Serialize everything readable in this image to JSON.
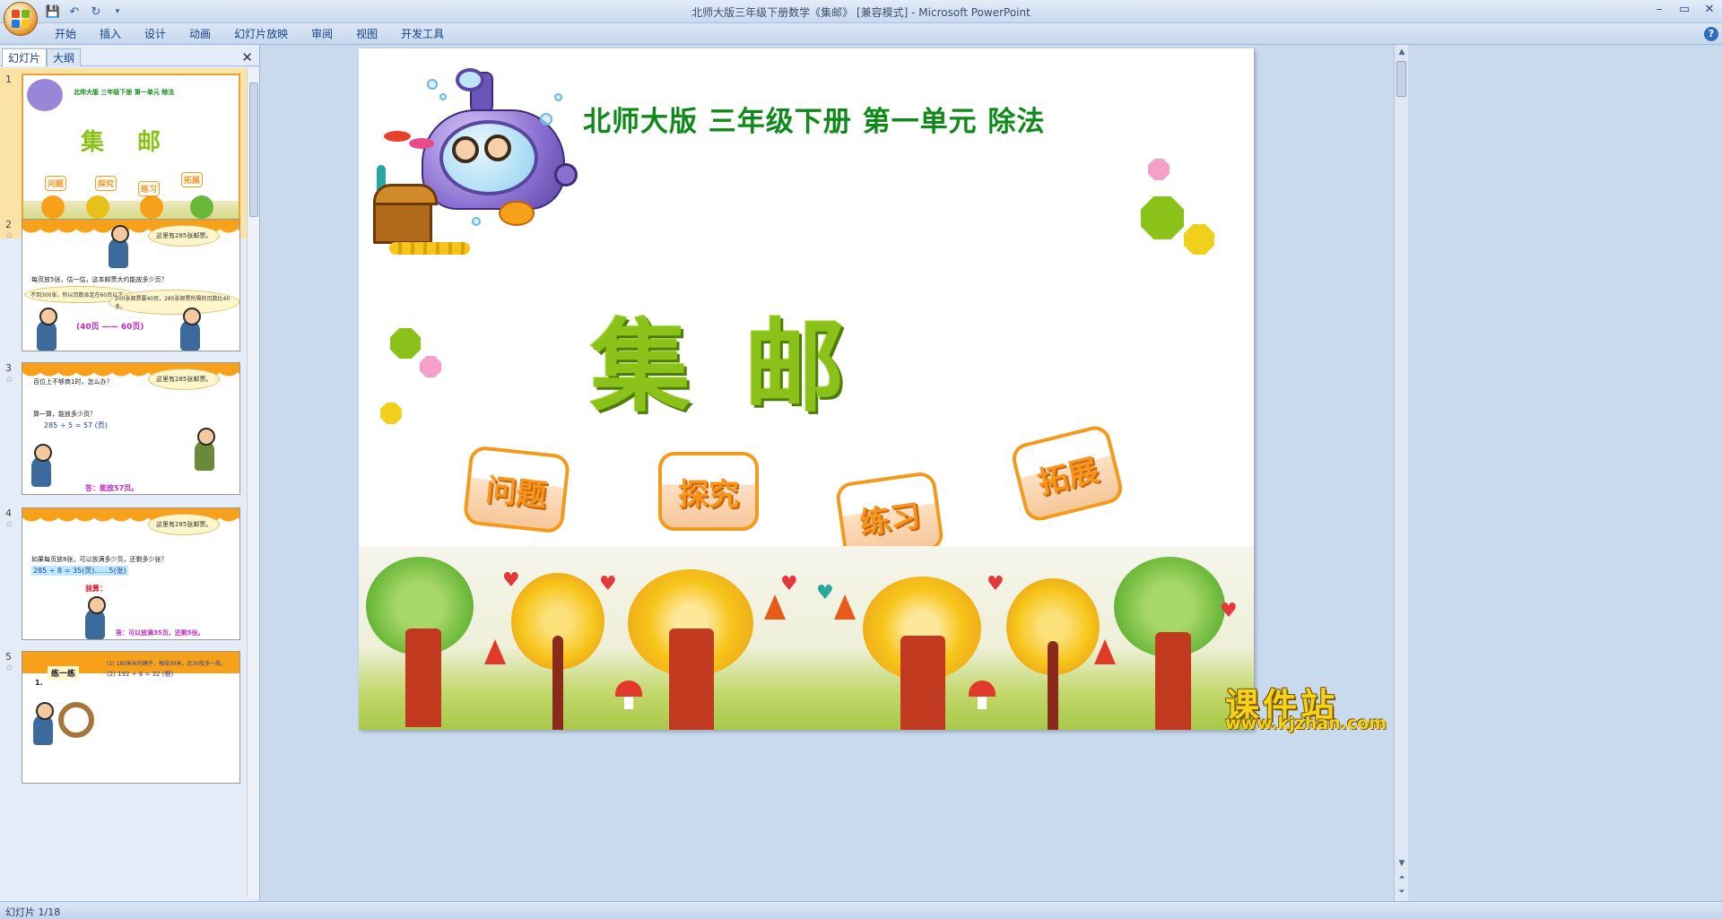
{
  "window": {
    "title": "北师大版三年级下册数学《集邮》 [兼容模式] - Microsoft PowerPoint"
  },
  "ribbon": {
    "tabs": [
      "开始",
      "插入",
      "设计",
      "动画",
      "幻灯片放映",
      "审阅",
      "视图",
      "开发工具"
    ]
  },
  "panel": {
    "tabs": [
      "幻灯片",
      "大纲"
    ],
    "close": "✕"
  },
  "thumbnails": [
    {
      "number": "1",
      "title_small": "北师大版 三年级下册 第一单元 除法",
      "main": "集 邮",
      "buttons": [
        "问题",
        "探究",
        "练习",
        "拓展"
      ]
    },
    {
      "number": "2",
      "bubble": "这里有285张邮票。",
      "question": "每页放5张，估一估，这本邮票大约能放多少页？",
      "left": "不到300张，所以页数肯定在60页以下。",
      "right": "200张邮票要40页，285张邮票所需的页数比40多。",
      "answer": "(40页 —— 60页)"
    },
    {
      "number": "3",
      "bubble": "这里有285张邮票。",
      "line1": "百位上不够商1时，怎么办？",
      "line2": "算一算，能放多少页？",
      "eq": "285 ÷ 5 = 57 (页)",
      "answer": "答：能放57页。"
    },
    {
      "number": "4",
      "bubble": "这里有285张邮票。",
      "question": "如果每页放8张，可以放满多少页，还剩多少张？",
      "eq": "285 ÷ 8 = 35(页)……5(张)",
      "check": "验算：",
      "answer": "答：可以放满35页，还剩5张。"
    },
    {
      "number": "5",
      "title": "练一练",
      "line1": "(1) 180米长的绳子，每段30米，比30段多一段。",
      "line2": "(2) 192 ÷ 6 = 32 (根)",
      "label": "1."
    }
  ],
  "slide": {
    "title": "北师大版  三年级下册  第一单元  除法",
    "main_title": "集邮",
    "buttons": [
      "问题",
      "探究",
      "练习",
      "拓展"
    ]
  },
  "watermark": {
    "brand": "课件站",
    "url": "www.kjzhan.com"
  },
  "status": {
    "slide_count": "幻灯片 1/18"
  },
  "colors": {
    "title_green": "#0f8a1a",
    "main_title_green": "#8ac21a",
    "button_orange": "#f39a1c"
  }
}
